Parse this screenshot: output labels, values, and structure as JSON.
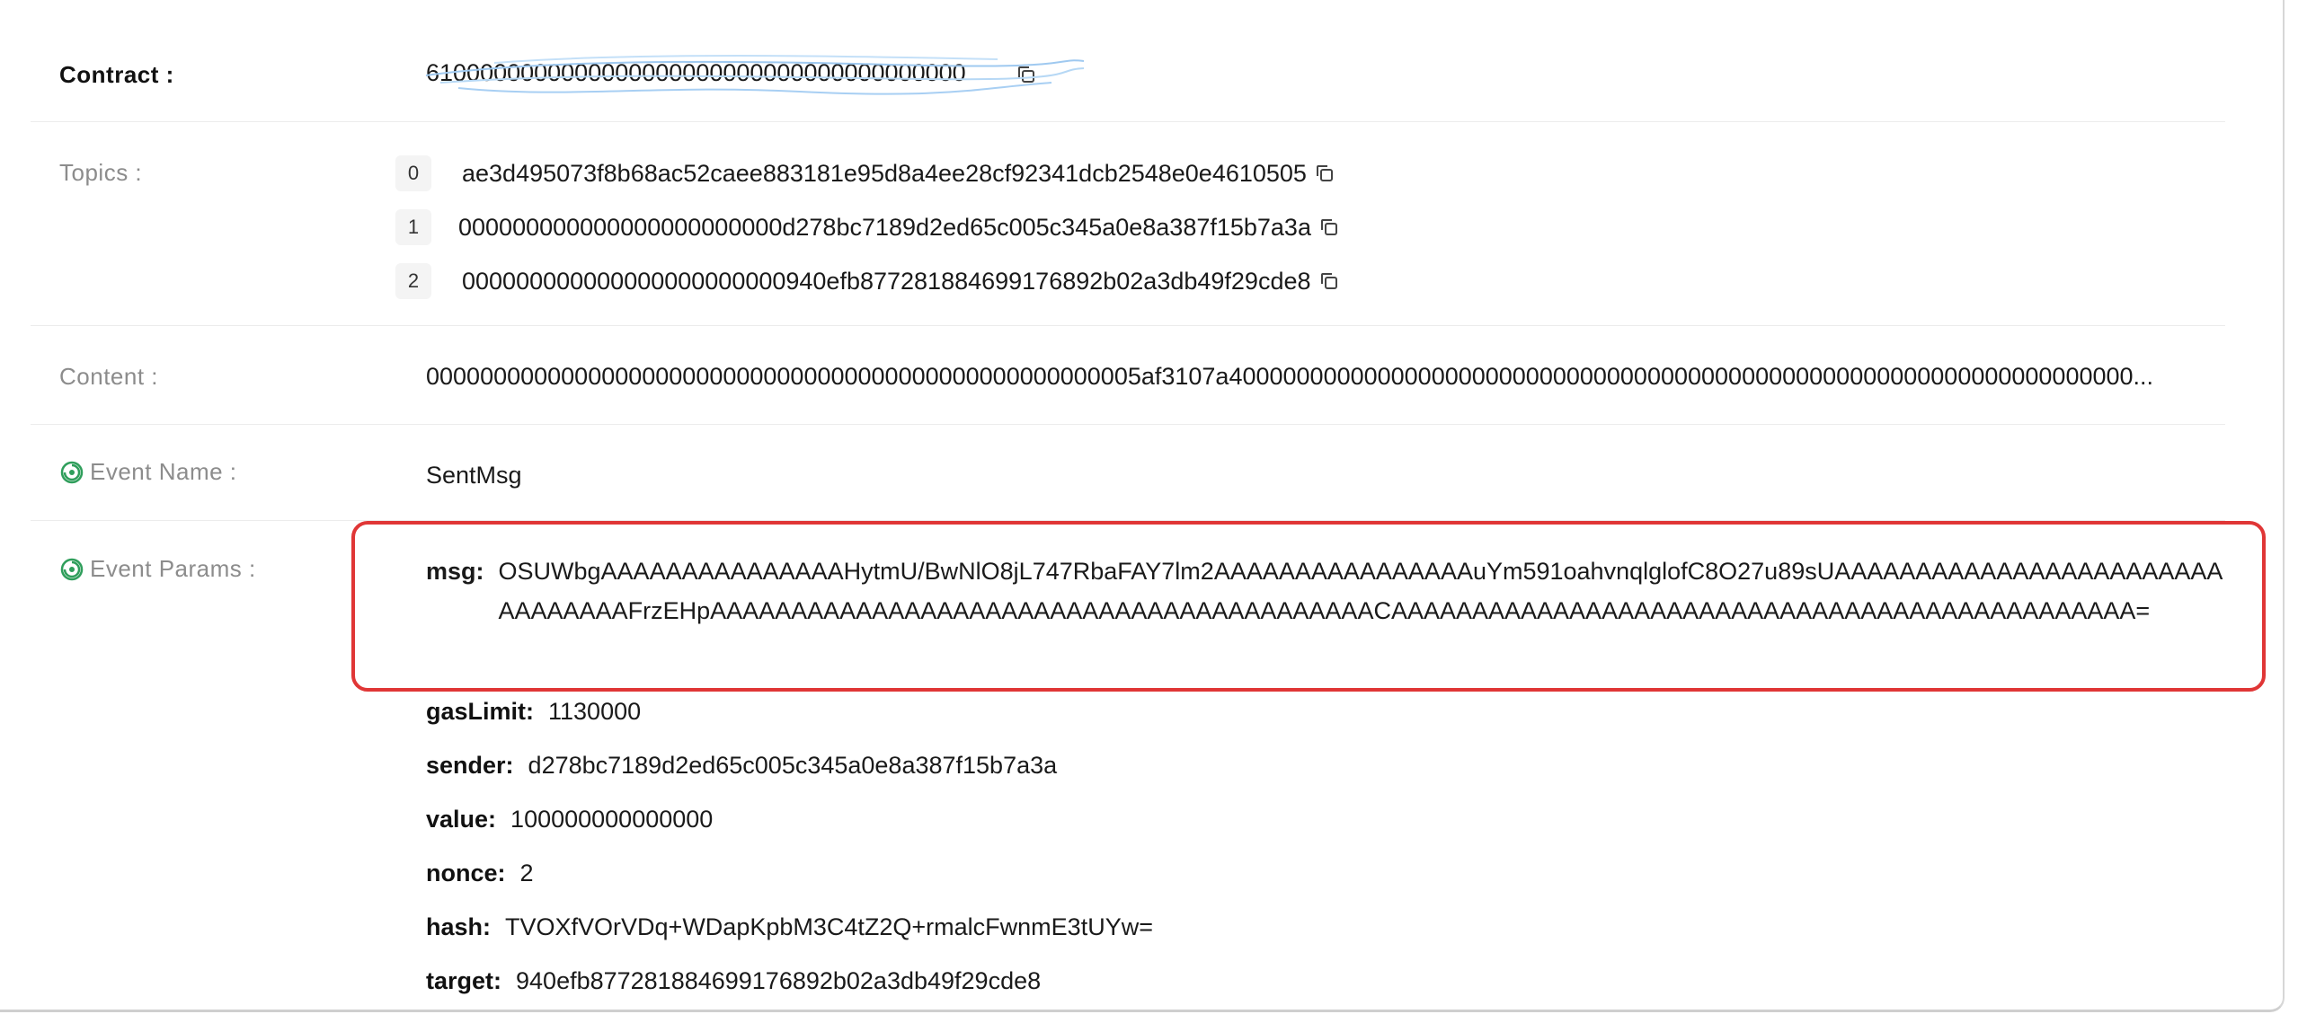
{
  "contract": {
    "label": "Contract :",
    "value": "6100000000000000000000000000000000000000"
  },
  "topics": {
    "label": "Topics :",
    "items": [
      {
        "index": "0",
        "value": "ae3d495073f8b68ac52caee883181e95d8a4ee28cf92341dcb2548e0e4610505"
      },
      {
        "index": "1",
        "value": "000000000000000000000000d278bc7189d2ed65c005c345a0e8a387f15b7a3a"
      },
      {
        "index": "2",
        "value": "000000000000000000000000940efb877281884699176892b02a3db49f29cde8"
      }
    ]
  },
  "content": {
    "label": "Content :",
    "value": "00000000000000000000000000000000000000000000000000005af3107a4000000000000000000000000000000000000000000000000000000000000000000..."
  },
  "event_name": {
    "label": "Event Name :",
    "value": "SentMsg"
  },
  "event_params": {
    "label": "Event Params :",
    "msg": {
      "key": "msg:",
      "value": "OSUWbgAAAAAAAAAAAAAAAHytmU/BwNlO8jL747RbaFAY7lm2AAAAAAAAAAAAAAAAuYm591oahvnqlglofC8O27u89sUAAAAAAAAAAAAAAAAAAAAAAAAAAAAAAAAFrzEHpAAAAAAAAAAAAAAAAAAAAAAAAAAAAAAAAAAAAAAAAACAAAAAAAAAAAAAAAAAAAAAAAAAAAAAAAAAAAAAAAAAAAAAA="
    },
    "items": [
      {
        "key": "gasLimit:",
        "value": "1130000"
      },
      {
        "key": "sender:",
        "value": "d278bc7189d2ed65c005c345a0e8a387f15b7a3a"
      },
      {
        "key": "value:",
        "value": "100000000000000"
      },
      {
        "key": "nonce:",
        "value": "2"
      },
      {
        "key": "hash:",
        "value": "TVOXfVOrVDq+WDapKpbM3C4tZ2Q+rmalcFwnmE3tUYw="
      },
      {
        "key": "target:",
        "value": "940efb877281884699176892b02a3db49f29cde8"
      }
    ]
  },
  "colors": {
    "status_green": "#2f9e5b",
    "highlight_red": "#e03636",
    "label_gray": "#8c8c8c"
  },
  "icons": {
    "copy": "copy-icon",
    "status": "event-status-icon"
  }
}
